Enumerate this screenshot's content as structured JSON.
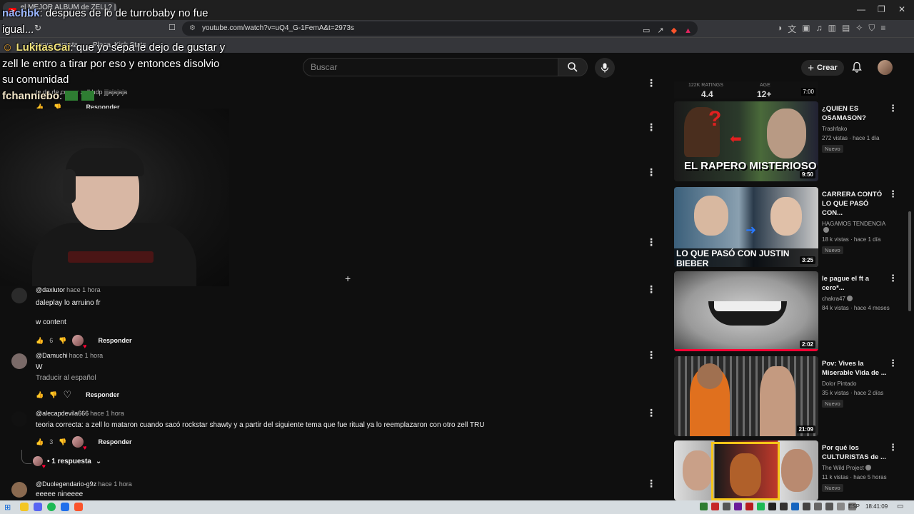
{
  "browser": {
    "tab_title": "el MEJOR ALBUM de ZELL? | W...",
    "tab_close": "✕",
    "url": "youtube.com/watch?v=uQ4_G-1FemA&t=2973s",
    "bookmarks": [
      "Nueva carpeta",
      "Placa",
      "Kick Stats"
    ]
  },
  "header": {
    "search_placeholder": "Buscar",
    "create_label": "Crear"
  },
  "chat": {
    "messages": [
      {
        "nick": "nachbk",
        "text": "despues de lo de turrobaby no fue igual...",
        "nick_color": "#9ab6ff"
      },
      {
        "nick": "LukitasCai",
        "text": "que yo sepa le dejo de gustar y zell le entro a tirar por eso y entonces disolvio su comunidad",
        "nick_color": "#f1e27a"
      },
      {
        "nick": "fchanniebo",
        "text": "",
        "nick_color": "#f3e6c8"
      }
    ]
  },
  "partial_comment": {
    "text": "te da de comer zell hdp jjjajajaja",
    "reply": "Responder"
  },
  "comments": [
    {
      "author": "@daxlutor",
      "time": "hace 1 hora",
      "text": "daleplay lo arruino fr",
      "text2": "w content",
      "likes": "6",
      "hearted": true,
      "reply": "Responder",
      "avatar_color": "#2b2b2b"
    },
    {
      "author": "@Damuchi",
      "time": "hace 1 hora",
      "text": "W",
      "text2": "Traducir al español",
      "likes": "",
      "hearted": false,
      "reply": "Responder",
      "avatar_color": "#7a6a68"
    },
    {
      "author": "@alecapdevila666",
      "time": "hace 1 hora",
      "text": "teoria correcta: a zell lo mataron cuando sacó rockstar shawty y a partir del siguiente tema que fue ritual ya lo reemplazaron con otro zell TRU",
      "text2": "",
      "likes": "3",
      "hearted": true,
      "reply": "Responder",
      "avatar_color": "#111111"
    },
    {
      "author": "@Duolegendario-g9z",
      "time": "hace 1 hora",
      "text": "eeeee nineeee",
      "text2": "",
      "likes": "",
      "hearted": false,
      "reply": "",
      "avatar_color": "#8a6a50"
    }
  ],
  "replies_label": "• 1 respuesta",
  "rating_strip": {
    "ratings_label": "122K RATINGS",
    "ratings_value": "4.4",
    "age_label": "AGE",
    "age_value": "12+",
    "duration": "7:00"
  },
  "videos": [
    {
      "title": "¿QUIEN ES OSAMASON?",
      "channel": "Trashfako",
      "verified": false,
      "meta": "272 vistas · hace 1 día",
      "badge": "Nuevo",
      "duration": "9:50",
      "thumb_text": "EL RAPERO MISTERIOSO"
    },
    {
      "title": "CARRERA CONTÓ LO QUE PASÓ CON...",
      "channel": "HAGAMOS TENDENCIA",
      "verified": true,
      "meta": "18 k vistas · hace 1 día",
      "badge": "Nuevo",
      "duration": "3:25",
      "thumb_text": "LO QUE PASÓ CON JUSTIN BIEBER"
    },
    {
      "title": "le pague el ft a cero*...",
      "channel": "chakra47",
      "verified": true,
      "meta": "84 k vistas · hace 4 meses",
      "badge": "",
      "duration": "2:02",
      "thumb_text": ""
    },
    {
      "title": "Pov: Vives la Miserable Vida de ...",
      "channel": "Dolor Pintado",
      "verified": false,
      "meta": "35 k vistas · hace 2 días",
      "badge": "Nuevo",
      "duration": "21:09",
      "thumb_text": ""
    },
    {
      "title": "Por qué los CULTURISTAS de ...",
      "channel": "The Wild Project",
      "verified": true,
      "meta": "11 k vistas · hace 5 horas",
      "badge": "Nuevo",
      "duration": "",
      "thumb_text": ""
    }
  ],
  "taskbar": {
    "lang": "ESP",
    "time": "18:41:09"
  }
}
